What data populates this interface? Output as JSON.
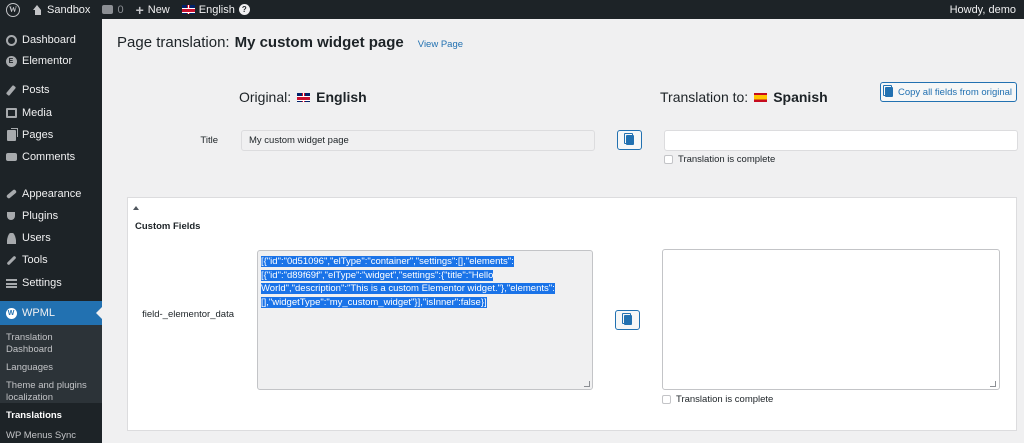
{
  "admin_bar": {
    "site_name": "Sandbox",
    "comments_count": "0",
    "new_label": "New",
    "language_label": "English",
    "greeting": "Howdy, demo"
  },
  "sidebar": {
    "items": [
      {
        "label": "Dashboard",
        "icon": "dashboard-icon"
      },
      {
        "label": "Elementor",
        "icon": "elementor-icon"
      },
      {
        "label": "Posts",
        "icon": "pin-icon"
      },
      {
        "label": "Media",
        "icon": "media-icon"
      },
      {
        "label": "Pages",
        "icon": "pages-icon"
      },
      {
        "label": "Comments",
        "icon": "comment-icon"
      },
      {
        "label": "Appearance",
        "icon": "brush-icon"
      },
      {
        "label": "Plugins",
        "icon": "plug-icon"
      },
      {
        "label": "Users",
        "icon": "user-icon"
      },
      {
        "label": "Tools",
        "icon": "wrench-icon"
      },
      {
        "label": "Settings",
        "icon": "sliders-icon"
      },
      {
        "label": "WPML",
        "icon": "wpml-icon",
        "active": true
      }
    ],
    "submenu": [
      {
        "label": "Translation Dashboard"
      },
      {
        "label": "Languages"
      },
      {
        "label": "Theme and plugins localization"
      },
      {
        "label": "Translations",
        "current": true
      },
      {
        "label": "WP Menus Sync"
      }
    ]
  },
  "page": {
    "title_label": "Page translation:",
    "title_name": "My custom widget page",
    "view_link": "View Page"
  },
  "columns": {
    "original_label": "Original:",
    "original_language": "English",
    "translation_label": "Translation to:",
    "translation_language": "Spanish",
    "copy_all_label": "Copy all fields from original"
  },
  "fields": {
    "title_label": "Title",
    "title_original_value": "My custom widget page",
    "title_translation_value": "",
    "complete_label": "Translation is complete"
  },
  "custom_fields": {
    "section_title": "Custom Fields",
    "field_label": "field-_elementor_data",
    "original_value": "[{\"id\":\"0d51096\",\"elType\":\"container\",\"settings\":[],\"elements\":[{\"id\":\"d89f69f\",\"elType\":\"widget\",\"settings\":{\"title\":\"Hello World\",\"description\":\"This is a custom Elementor widget.\"},\"elements\":[],\"widgetType\":\"my_custom_widget\"}],\"isInner\":false}]",
    "translation_value": "",
    "complete_label": "Translation is complete"
  },
  "colors": {
    "accent": "#2271b1",
    "admin_dark": "#1d2327",
    "selection": "#1a73e8"
  }
}
